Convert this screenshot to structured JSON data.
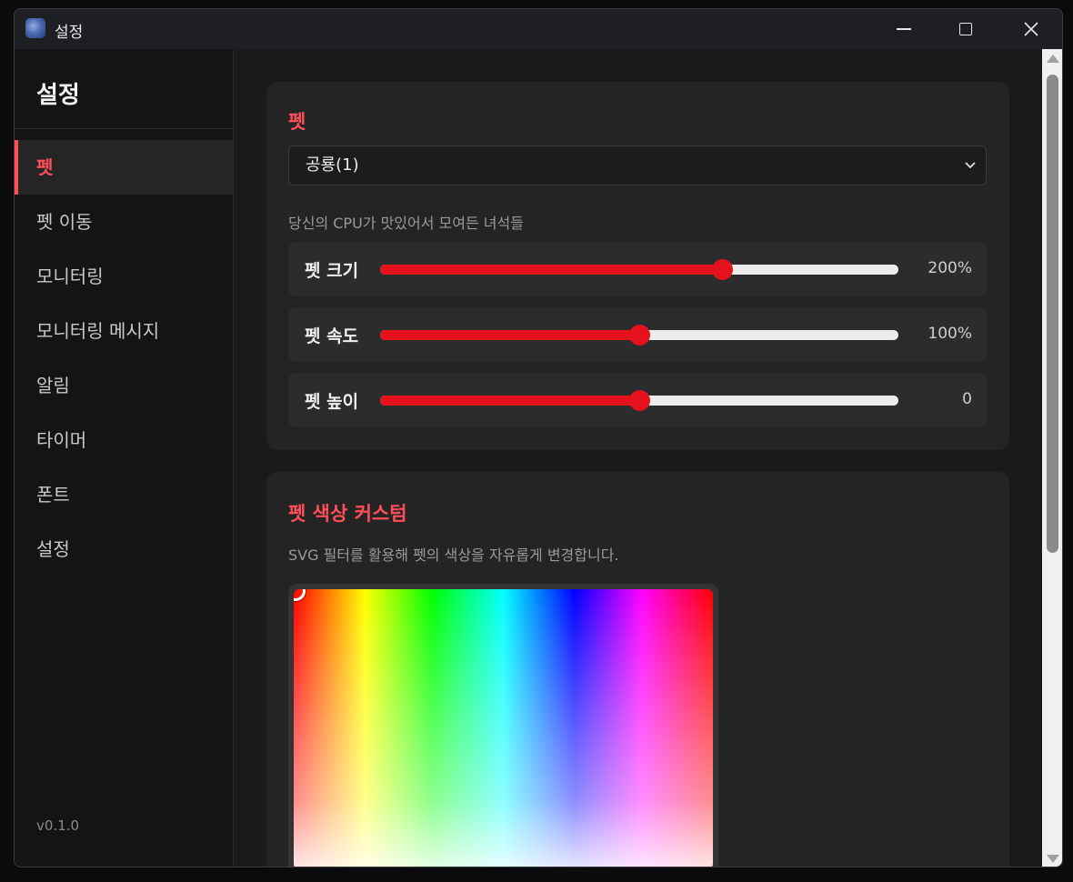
{
  "window": {
    "title": "설정"
  },
  "sidebar": {
    "title": "설정",
    "items": [
      {
        "label": "펫",
        "active": true
      },
      {
        "label": "펫 이동"
      },
      {
        "label": "모니터링"
      },
      {
        "label": "모니터링 메시지"
      },
      {
        "label": "알림"
      },
      {
        "label": "타이머"
      },
      {
        "label": "폰트"
      },
      {
        "label": "설정"
      }
    ],
    "version": "v0.1.0"
  },
  "pet_card": {
    "title": "펫",
    "select_value": "공룡(1)",
    "description": "당신의 CPU가 맛있어서 모여든 녀석들",
    "sliders": [
      {
        "label": "펫 크기",
        "value": "200%",
        "fraction": 0.66
      },
      {
        "label": "펫 속도",
        "value": "100%",
        "fraction": 0.5
      },
      {
        "label": "펫 높이",
        "value": "0",
        "fraction": 0.5
      }
    ]
  },
  "color_card": {
    "title": "펫 색상 커스텀",
    "description": "SVG 필터를 활용해 펫의 색상을 자유롭게 변경합니다."
  },
  "colors": {
    "accent": "#ff4d5a",
    "slider": "#e3121c",
    "background": "#1a1a1a"
  }
}
